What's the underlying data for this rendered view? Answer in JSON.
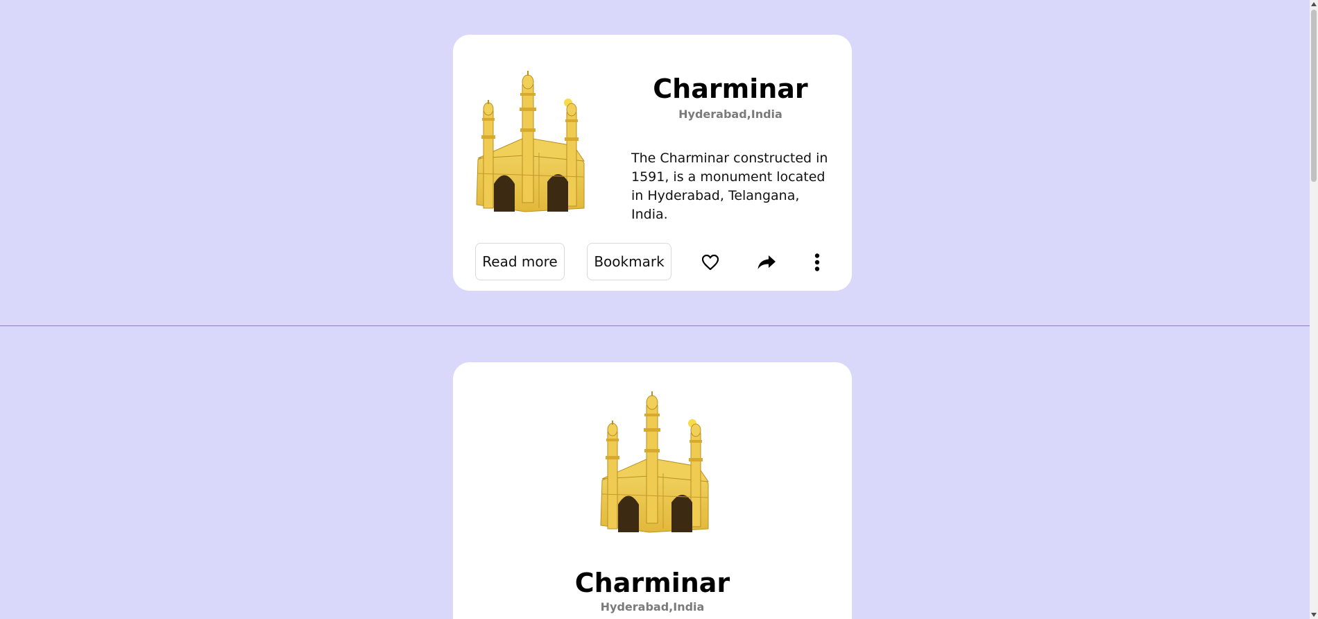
{
  "cards": [
    {
      "title": "Charminar",
      "location": "Hyderabad,India",
      "description": "The Charminar constructed in 1591, is a monument located in Hyderabad, Telangana, India.",
      "read_more_label": "Read more",
      "bookmark_label": "Bookmark"
    },
    {
      "title": "Charminar",
      "location": "Hyderabad,India"
    }
  ],
  "icons": {
    "like": "heart-icon",
    "share": "share-icon",
    "more": "more-vertical-icon"
  },
  "colors": {
    "page_background": "#d9d8fb",
    "card_background": "#ffffff",
    "monument_gold": "#e8c54a",
    "subtitle_gray": "#7a7a7a"
  }
}
